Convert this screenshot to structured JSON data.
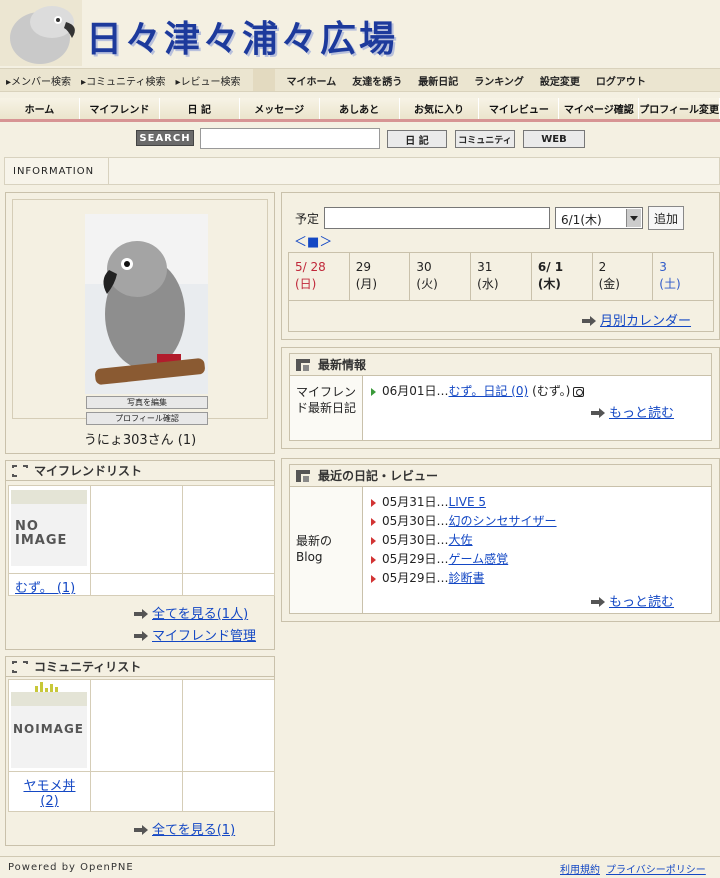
{
  "header": {
    "site_title": "日々津々浦々広場"
  },
  "nav_search": [
    "メンバー検索",
    "コミュニティ検索",
    "レビュー検索"
  ],
  "nav_main": [
    "マイホーム",
    "友達を誘う",
    "最新日記",
    "ランキング",
    "設定変更",
    "ログアウト"
  ],
  "nav_tabs": [
    "ホーム",
    "マイフレンド",
    "日 記",
    "メッセージ",
    "あしあと",
    "お気に入り",
    "マイレビュー",
    "マイページ確認",
    "プロフィール変更"
  ],
  "search": {
    "label": "SEARCH",
    "placeholder": "",
    "btn_diary": "日 記",
    "btn_community": "コミュニティ",
    "btn_web": "WEB"
  },
  "info": {
    "label": "INFORMATION"
  },
  "profile": {
    "edit_photo": "写真を編集",
    "check_profile": "プロフィール確認",
    "name": "うにょ303さん (1)"
  },
  "friends": {
    "title": "マイフレンドリスト",
    "noimage": "NO IMAGE",
    "friend_name": "むず。 (1)",
    "see_all": "全てを見る(1人)",
    "manage": "マイフレンド管理"
  },
  "communities": {
    "title": "コミュニティリスト",
    "noimage": "NOIMAGE",
    "community_name": "ヤモメ丼 (2)",
    "see_all": "全てを見る(1)"
  },
  "schedule": {
    "label": "予定",
    "input_value": "",
    "selected_day": "6/1(木)",
    "add": "追加",
    "nav": "＜■＞",
    "days": [
      {
        "d": "5/ 28",
        "w": "(日)",
        "cls": "sun"
      },
      {
        "d": "29",
        "w": "(月)",
        "cls": ""
      },
      {
        "d": "30",
        "w": "(火)",
        "cls": ""
      },
      {
        "d": "31",
        "w": "(水)",
        "cls": ""
      },
      {
        "d": "6/ 1",
        "w": "(木)",
        "cls": "today"
      },
      {
        "d": "2",
        "w": "(金)",
        "cls": ""
      },
      {
        "d": "3",
        "w": "(土)",
        "cls": "sat"
      }
    ],
    "month_calendar": "月別カレンダー"
  },
  "news": {
    "title": "最新情報",
    "col_label": "マイフレンド最新日記",
    "entry_date": "06月01日…",
    "entry_link": "むず。日記 (0)",
    "entry_author": "(むず。)",
    "more": "もっと読む"
  },
  "blog": {
    "title": "最近の日記・レビュー",
    "col_label": "最新のBlog",
    "entries": [
      {
        "date": "05月31日…",
        "title": "LIVE 5"
      },
      {
        "date": "05月30日…",
        "title": "幻のシンセサイザー"
      },
      {
        "date": "05月30日…",
        "title": "大佐"
      },
      {
        "date": "05月29日…",
        "title": "ゲーム感覚"
      },
      {
        "date": "05月29日…",
        "title": "診断書"
      }
    ],
    "more": "もっと読む"
  },
  "footer": {
    "powered": "Powered by OpenPNE",
    "terms": "利用規約",
    "privacy": "プライバシーポリシー"
  }
}
